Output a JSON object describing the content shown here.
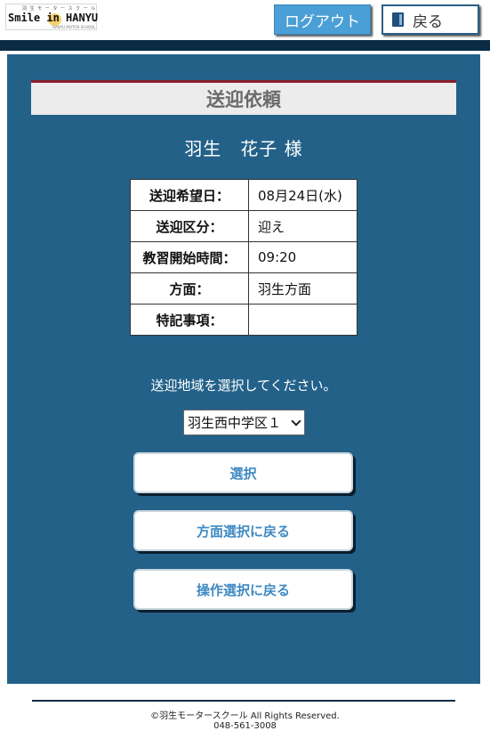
{
  "header": {
    "logo": {
      "small_text": "羽 生 モ ー タ ー ス ク ー ル",
      "text": "Smile in HANYU",
      "under_text": "HANYU MOTOR SCHOOL"
    },
    "logout_label": "ログアウト",
    "back_label": "戻る"
  },
  "page": {
    "title": "送迎依頼",
    "user_name": "羽生　花子 様"
  },
  "info_table": [
    {
      "label": "送迎希望日：",
      "value": "08月24日(水)"
    },
    {
      "label": "送迎区分：",
      "value": "迎え"
    },
    {
      "label": "教習開始時間：",
      "value": "09:20"
    },
    {
      "label": "方面：",
      "value": "羽生方面"
    },
    {
      "label": "特記事項：",
      "value": ""
    }
  ],
  "area_select": {
    "prompt": "送迎地域を選択してください。",
    "selected": "羽生西中学区１"
  },
  "actions": {
    "select_label": "選択",
    "back_direction_label": "方面選択に戻る",
    "back_operation_label": "操作選択に戻る"
  },
  "footer": {
    "copyright": "©羽生モータースクール All Rights Reserved.",
    "tel": "048-561-3008"
  },
  "colors": {
    "main_bg": "#236189",
    "top_bar": "#0b2b45",
    "logout_bg": "#4a9fd6",
    "title_accent": "#8b1f2b",
    "button_text": "#3f8ac2"
  }
}
